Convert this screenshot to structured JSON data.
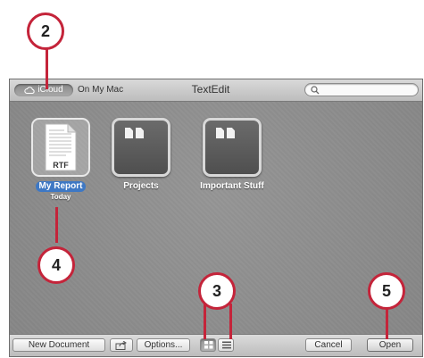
{
  "titlebar": {
    "tab_icloud": "iCloud",
    "tab_on_my_mac": "On My Mac",
    "title": "TextEdit",
    "search_placeholder": ""
  },
  "documents": [
    {
      "name": "My Report",
      "subtitle": "Today",
      "badge": "RTF",
      "kind": "document",
      "selected": true
    },
    {
      "name": "Projects",
      "kind": "folder",
      "selected": false
    },
    {
      "name": "Important Stuff",
      "kind": "folder",
      "selected": false
    }
  ],
  "bottombar": {
    "new_document": "New Document",
    "options": "Options...",
    "cancel": "Cancel",
    "open": "Open",
    "view_mode": "icon"
  },
  "callouts": {
    "c2": "2",
    "c3": "3",
    "c4": "4",
    "c5": "5"
  },
  "colors": {
    "accent_selection": "#3e78c4",
    "callout_ring": "#c4243a",
    "window_background": "#8f8f8f"
  }
}
